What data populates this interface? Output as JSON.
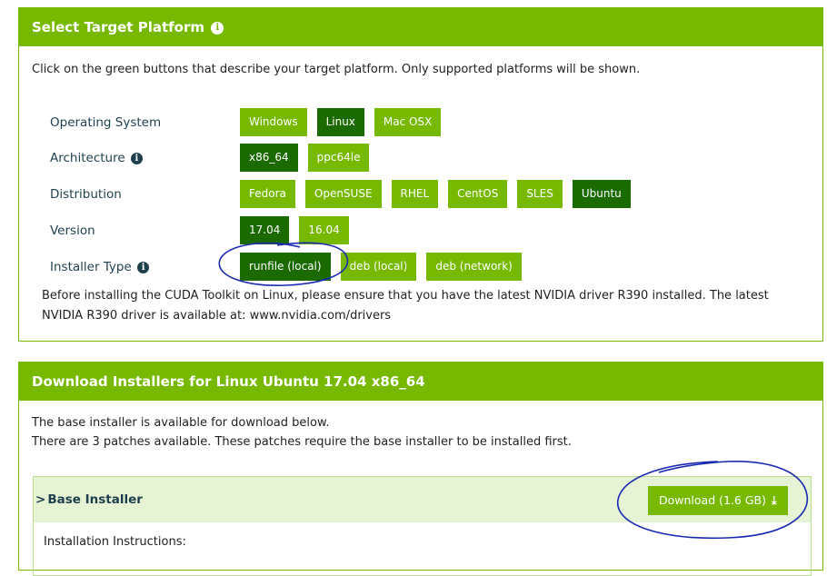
{
  "select_panel": {
    "title": "Select Target Platform",
    "info_glyph": "i",
    "intro": "Click on the green buttons that describe your target platform. Only supported platforms will be shown.",
    "rows": [
      {
        "label": "Operating System",
        "info": false,
        "options": [
          "Windows",
          "Linux",
          "Mac OSX"
        ],
        "selected": "Linux"
      },
      {
        "label": "Architecture",
        "info": true,
        "options": [
          "x86_64",
          "ppc64le"
        ],
        "selected": "x86_64"
      },
      {
        "label": "Distribution",
        "info": false,
        "options": [
          "Fedora",
          "OpenSUSE",
          "RHEL",
          "CentOS",
          "SLES",
          "Ubuntu"
        ],
        "selected": "Ubuntu"
      },
      {
        "label": "Version",
        "info": false,
        "options": [
          "17.04",
          "16.04"
        ],
        "selected": "17.04"
      },
      {
        "label": "Installer Type",
        "info": true,
        "options": [
          "runfile (local)",
          "deb (local)",
          "deb (network)"
        ],
        "selected": "runfile (local)"
      }
    ],
    "note_line1": "Before installing the CUDA Toolkit on Linux, please ensure that you have the latest NVIDIA driver R390 installed. The latest",
    "note_line2": "NVIDIA R390 driver is available at: www.nvidia.com/drivers"
  },
  "download_panel": {
    "title": "Download Installers for Linux Ubuntu 17.04 x86_64",
    "line1": "The base installer is available for download below.",
    "line2": "There are 3 patches available. These patches require the base installer to be installed first.",
    "base_installer": {
      "chevron": ">",
      "title": "Base Installer",
      "download_label": "Download (1.6 GB)",
      "download_icon": "⤓",
      "instructions_label": "Installation Instructions:"
    }
  },
  "colors": {
    "brand_green": "#76b900",
    "selected_green": "#1a6a00",
    "light_green_bg": "#e7f3d5",
    "label_text": "#1e3f4c",
    "annotation_ink": "#1a2bb0"
  },
  "icons": {
    "info": "info-circle-icon",
    "chevron": "chevron-right-icon",
    "download": "download-icon"
  }
}
